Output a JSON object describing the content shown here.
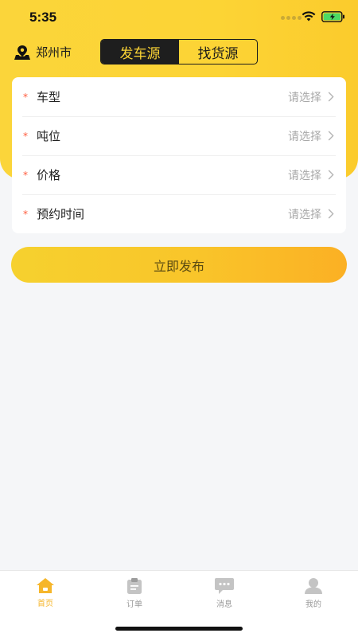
{
  "status_bar": {
    "time": "5:35"
  },
  "header": {
    "location": "郑州市",
    "tabs": [
      {
        "label": "发车源",
        "active": true
      },
      {
        "label": "找货源",
        "active": false
      }
    ]
  },
  "form": {
    "rows": [
      {
        "required": "*",
        "label": "车型",
        "value": "请选择"
      },
      {
        "required": "*",
        "label": "吨位",
        "value": "请选择"
      },
      {
        "required": "*",
        "label": "价格",
        "value": "请选择"
      },
      {
        "required": "*",
        "label": "预约时间",
        "value": "请选择"
      }
    ]
  },
  "publish_button": {
    "label": "立即发布"
  },
  "tab_bar": {
    "items": [
      {
        "label": "首页",
        "icon": "home-icon",
        "active": true
      },
      {
        "label": "订单",
        "icon": "clipboard-icon",
        "active": false
      },
      {
        "label": "消息",
        "icon": "message-icon",
        "active": false
      },
      {
        "label": "我的",
        "icon": "user-icon",
        "active": false
      }
    ]
  },
  "colors": {
    "accent_yellow": "#fcd435",
    "active_tab": "#f6b62b",
    "dark": "#1e1e1e",
    "required": "#ff5a3c"
  }
}
